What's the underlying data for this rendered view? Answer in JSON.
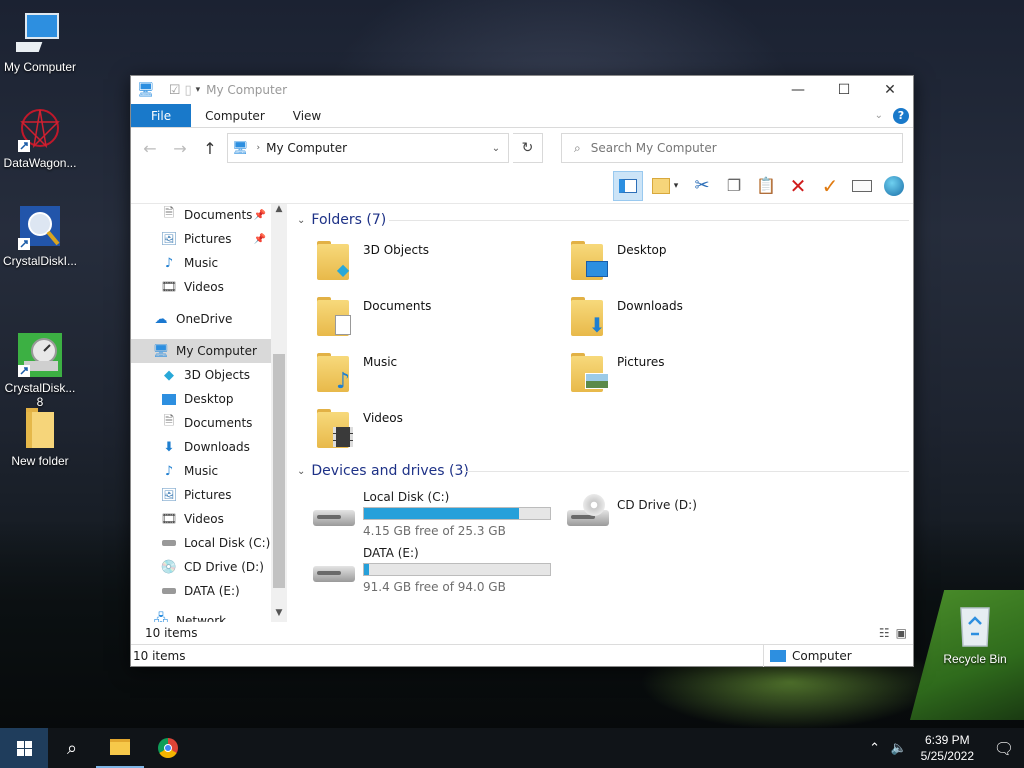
{
  "desktop": {
    "icons": [
      {
        "label": "My Computer"
      },
      {
        "label": "DataWagon..."
      },
      {
        "label": "CrystalDiskI..."
      },
      {
        "label": "CrystalDisk...\n8"
      },
      {
        "label": "New folder"
      },
      {
        "label": "Recycle Bin"
      }
    ]
  },
  "window": {
    "title": "My Computer",
    "controls": {
      "minimize": "—",
      "maximize": "☐",
      "close": "✕"
    },
    "ribbon_tabs": [
      "File",
      "Computer",
      "View"
    ],
    "help": "?",
    "address": {
      "path": "My Computer"
    },
    "search": {
      "placeholder": "Search My Computer"
    },
    "nav": {
      "quick_access": [
        {
          "label": "Documents",
          "pinned": true
        },
        {
          "label": "Pictures",
          "pinned": true
        },
        {
          "label": "Music",
          "pinned": false
        },
        {
          "label": "Videos",
          "pinned": false
        }
      ],
      "onedrive": "OneDrive",
      "my_computer": "My Computer",
      "computer_children": [
        "3D Objects",
        "Desktop",
        "Documents",
        "Downloads",
        "Music",
        "Pictures",
        "Videos",
        "Local Disk (C:)",
        "CD Drive (D:)",
        "DATA (E:)"
      ],
      "network": "Network"
    },
    "folders_header": "Folders (7)",
    "folders": [
      "3D Objects",
      "Desktop",
      "Documents",
      "Downloads",
      "Music",
      "Pictures",
      "Videos"
    ],
    "drives_header": "Devices and drives (3)",
    "drives": [
      {
        "name": "Local Disk (C:)",
        "free": "4.15 GB free of 25.3 GB",
        "used_fraction": 0.836
      },
      {
        "name": "CD Drive (D:)"
      },
      {
        "name": "DATA (E:)",
        "free": "91.4 GB free of 94.0 GB",
        "used_fraction": 0.028
      }
    ],
    "item_count": "10 items",
    "status": {
      "left": "10 items",
      "zone": "Computer"
    }
  },
  "taskbar": {
    "time": "6:39 PM",
    "date": "5/25/2022"
  }
}
